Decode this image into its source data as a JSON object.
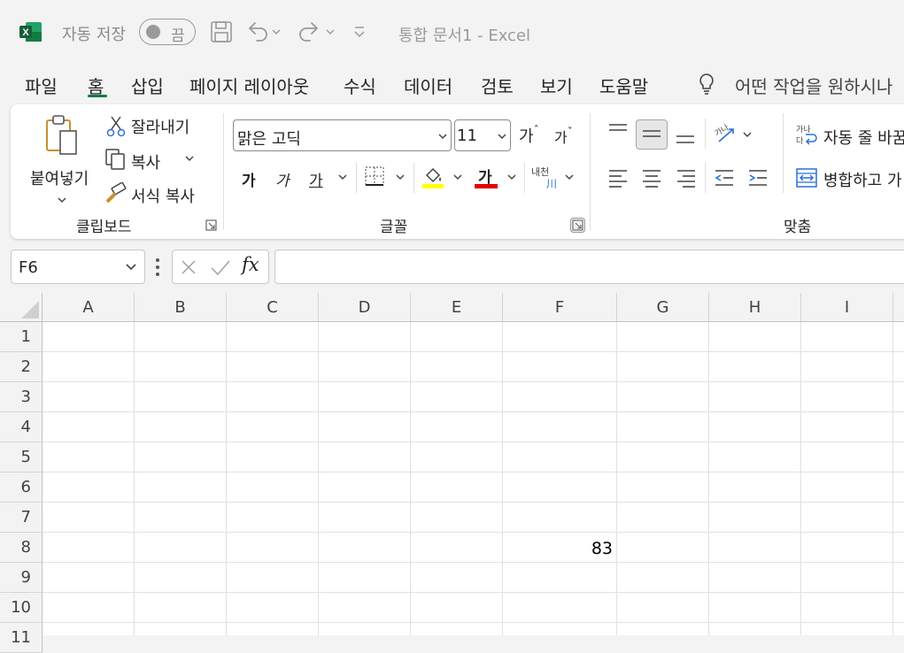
{
  "title_bar": {
    "autosave_label": "자동 저장",
    "autosave_toggle": "끔",
    "document_title": "통합 문서1  -  Excel",
    "icons": [
      "excel-logo-icon",
      "save-icon",
      "undo-icon",
      "redo-icon",
      "customize-qat-icon"
    ]
  },
  "tabs": [
    {
      "label": "파일"
    },
    {
      "label": "홈",
      "active": true
    },
    {
      "label": "삽입"
    },
    {
      "label": "페이지 레이아웃"
    },
    {
      "label": "수식"
    },
    {
      "label": "데이터"
    },
    {
      "label": "검토"
    },
    {
      "label": "보기"
    },
    {
      "label": "도움말"
    }
  ],
  "search": {
    "placeholder": "어떤 작업을 원하시나"
  },
  "ribbon": {
    "clipboard": {
      "paste": "붙여넣기",
      "cut": "잘라내기",
      "copy": "복사",
      "format_painter": "서식 복사",
      "label": "클립보드"
    },
    "font": {
      "family": "맑은 고딕",
      "size": "11",
      "grow": "가",
      "shrink": "가",
      "bold": "가",
      "italic": "가",
      "underline": "가",
      "font_color": "가",
      "phonetic": "내천",
      "label": "글꼴",
      "highlight_color": "#ffff00",
      "text_color": "#e00000"
    },
    "alignment": {
      "wrap_text": "자동 줄 바꿈",
      "merge": "병합하고 가",
      "label": "맞춤"
    }
  },
  "formula_bar": {
    "name_box": "F6",
    "fx": "fx",
    "value": ""
  },
  "sheet": {
    "columns": [
      "A",
      "B",
      "C",
      "D",
      "E",
      "F",
      "G",
      "H",
      "I"
    ],
    "rows": [
      "1",
      "2",
      "3",
      "4",
      "5",
      "6",
      "7",
      "8",
      "9",
      "10",
      "11"
    ],
    "cells": [
      {
        "ref": "F8",
        "value": "83"
      }
    ]
  },
  "colors": {
    "accent": "#107c41",
    "grid_line": "#e1e1e1"
  }
}
